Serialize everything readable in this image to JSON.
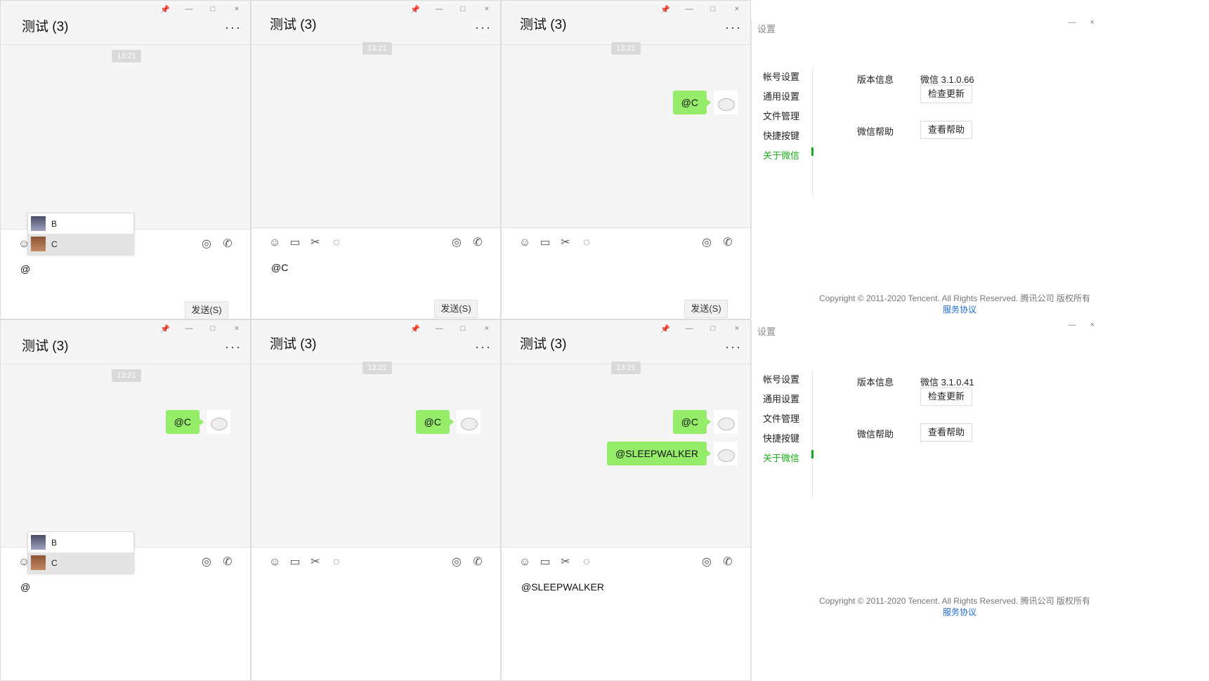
{
  "chat_title": "测试 (3)",
  "time_label": "13:21",
  "window_controls": [
    "📌",
    "—",
    "□",
    "×"
  ],
  "more_label": "···",
  "send_label": "发送(S)",
  "mention_list": [
    {
      "name": "B"
    },
    {
      "name": "C"
    }
  ],
  "panels": [
    {
      "input_text": "@",
      "messages": []
    },
    {
      "input_text": "@C",
      "messages": []
    },
    {
      "input_text": "",
      "messages": [
        "@C"
      ]
    },
    {
      "input_text": "@",
      "messages": [
        "@C"
      ]
    },
    {
      "input_text": "",
      "messages": [
        "@C"
      ]
    },
    {
      "input_text": "@SLEEPWALKER",
      "messages": [
        "@C",
        "@SLEEPWALKER"
      ]
    }
  ],
  "settings": {
    "title": "设置",
    "nav": [
      "帐号设置",
      "通用设置",
      "文件管理",
      "快捷按键",
      "关于微信"
    ],
    "version_label": "版本信息",
    "help_label": "微信帮助",
    "check_update": "检查更新",
    "view_help": "查看帮助",
    "versions": [
      "微信 3.1.0.66",
      "微信 3.1.0.41"
    ],
    "copyright": "Copyright © 2011-2020 Tencent. All Rights Reserved. 腾讯公司 版权所有",
    "agreement": "服务协议"
  },
  "colors": {
    "bubble": "#95ec69",
    "active_nav": "#1aad19",
    "link": "#1c6bd1"
  }
}
